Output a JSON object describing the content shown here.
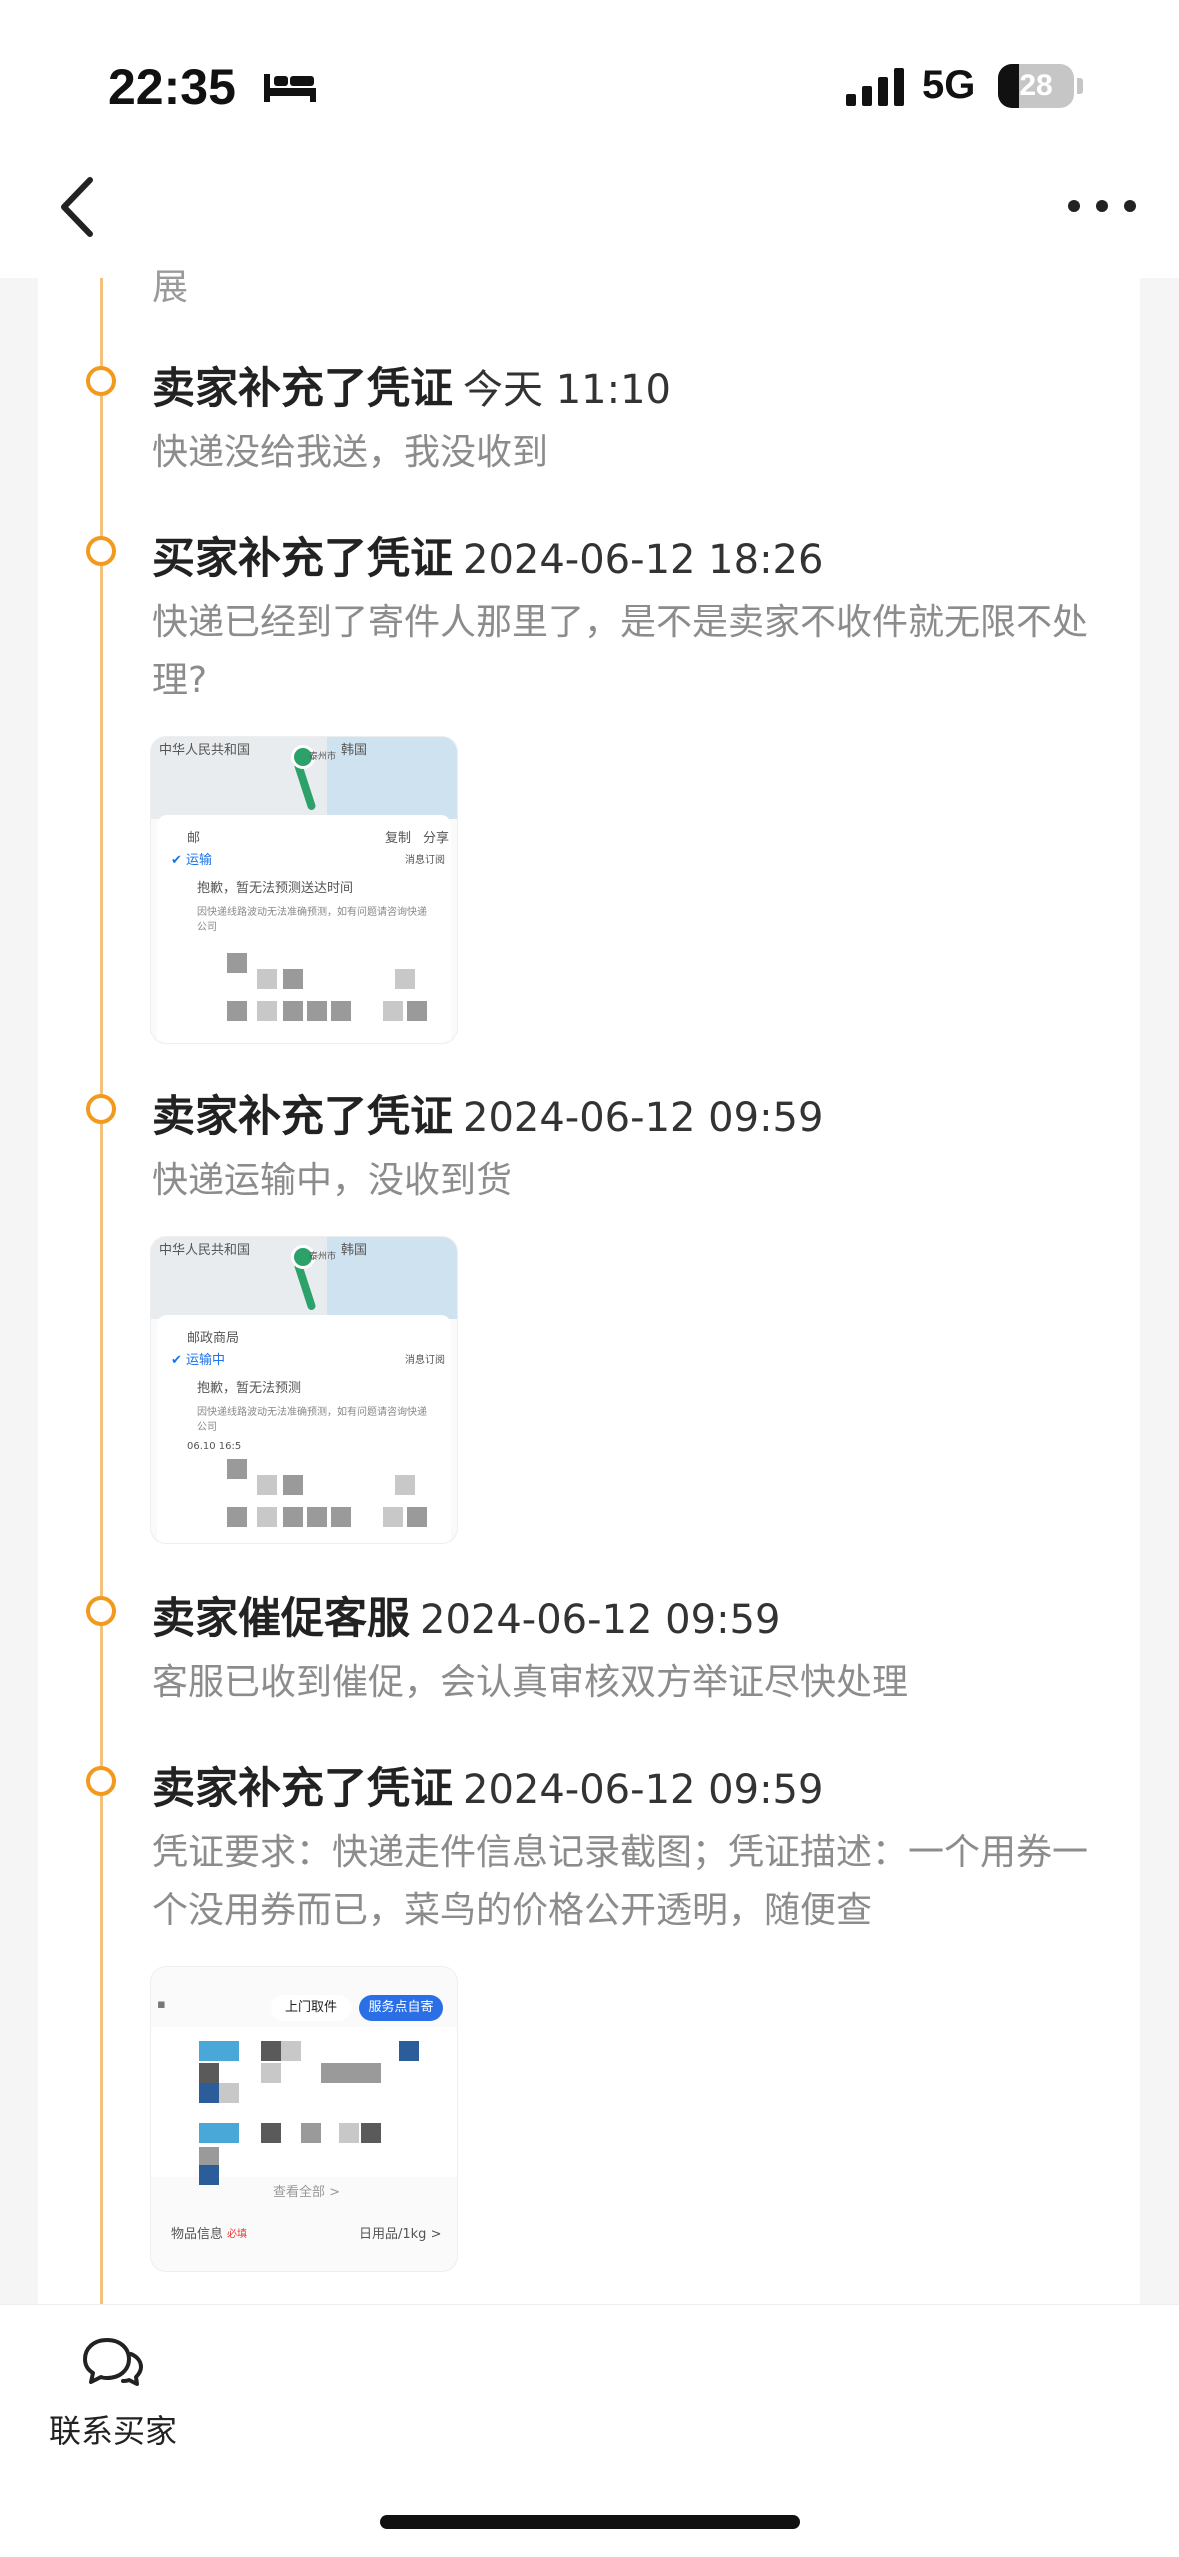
{
  "status_bar": {
    "time": "22:35",
    "network": "5G",
    "battery": "28",
    "battery_percent": 28
  },
  "nav": {
    "back_icon": "chevron-left-icon",
    "more_icon": "ellipsis-icon"
  },
  "timeline": {
    "partial_text": "展",
    "events": [
      {
        "title": "卖家补充了凭证",
        "time": "今天 11:10",
        "desc": "快递没给我送，我没收到"
      },
      {
        "title": "买家补充了凭证",
        "time": "2024-06-12 18:26",
        "desc": "快递已经到了寄件人那里了，是不是卖家不收件就无限不处理?"
      },
      {
        "title": "卖家补充了凭证",
        "time": "2024-06-12 09:59",
        "desc": "快递运输中，没收到货"
      },
      {
        "title": "卖家催促客服",
        "time": "2024-06-12 09:59",
        "desc": "客服已收到催促，会认真审核双方举证尽快处理"
      },
      {
        "title": "卖家补充了凭证",
        "time": "2024-06-12 09:59",
        "desc": "凭证要求：快递走件信息记录截图；凭证描述：一个用券一个没用券而已，菜鸟的价格公开透明，随便查"
      }
    ],
    "thumb1": {
      "map_label": "中华人民共和国",
      "map_label2": "韩国",
      "city": "泰州市",
      "carrier": "邮",
      "copy": "复制",
      "share": "分享",
      "status": "运输",
      "subscribe": "消息订阅",
      "notice_title": "抱歉，暂无法预测送达时间",
      "notice_body": "因快递线路波动无法准确预测，如有问题请咨询快递公司"
    },
    "thumb2": {
      "map_label": "中华人民共和国",
      "map_label2": "韩国",
      "city": "泰州市",
      "carrier": "邮政商局",
      "status": "运输中",
      "subscribe": "消息订阅",
      "notice_title": "抱歉，暂无法预测",
      "notice_body": "因快递线路波动无法准确预测，如有问题请咨询快递公司",
      "date": "06.10 16:5"
    },
    "thumb3": {
      "tab1": "上门取件",
      "tab2": "服务点自寄",
      "view_all": "查看全部 >",
      "item_label": "物品信息",
      "required": "必填",
      "item_value": "日用品/1kg >"
    }
  },
  "bottom": {
    "contact_label": "联系买家",
    "contact_icon": "chat-bubbles-icon"
  }
}
